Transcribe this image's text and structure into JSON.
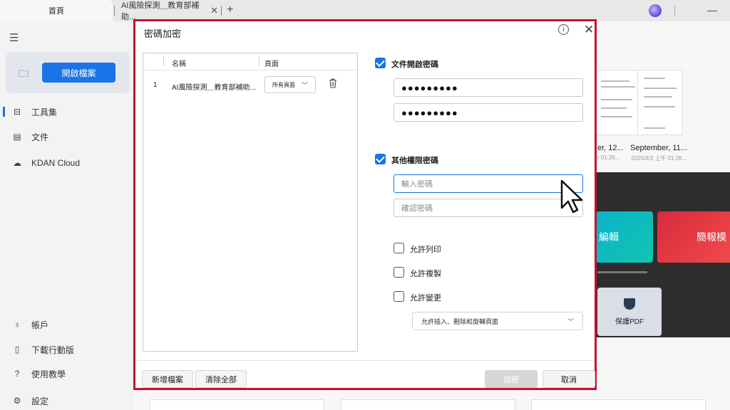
{
  "tabs": {
    "home_label": "首頁",
    "doc_label": "AI風險探測＿教育部補助...",
    "close_glyph": "✕",
    "new_tab_glyph": "+",
    "minimize_glyph": "—"
  },
  "sidebar": {
    "open_button": "開啟檔案",
    "items": [
      {
        "label": "工具集",
        "icon": "toolbox-icon"
      },
      {
        "label": "文件",
        "icon": "document-icon"
      },
      {
        "label": "KDAN Cloud",
        "icon": "cloud-icon"
      }
    ],
    "bottom_items": [
      {
        "label": "帳戶",
        "icon": "account-icon"
      },
      {
        "label": "下載行動版",
        "icon": "mobile-icon"
      },
      {
        "label": "使用教學",
        "icon": "help-icon"
      },
      {
        "label": "設定",
        "icon": "gear-icon"
      }
    ]
  },
  "background": {
    "recent": [
      {
        "title": "er, 12...",
        "sub": "r 01:26..."
      },
      {
        "title": "September, 11...",
        "sub": "2025/4/3 上午 01:26..."
      }
    ],
    "tool_card_1": "編輯",
    "tool_card_2": "簡報模",
    "protect_label": "保護PDF"
  },
  "dialog": {
    "title": "密碼加密",
    "file_table": {
      "col_name": "名稱",
      "col_pages": "頁面",
      "rows": [
        {
          "num": "1",
          "name": "AI風險探測＿教育部補助...",
          "pages": "所有頁面"
        }
      ]
    },
    "open_password": {
      "label": "文件開啟密碼",
      "checked": true,
      "password": "●●●●●●●●●",
      "confirm": "●●●●●●●●●"
    },
    "permission_password": {
      "label": "其他權限密碼",
      "checked": true,
      "placeholder": "輸入密碼",
      "confirm_placeholder": "確認密碼"
    },
    "permissions": {
      "print": "允許列印",
      "copy": "允許複製",
      "change": "允許變更",
      "change_option": "允許插入、刪除和旋轉頁面"
    },
    "footer": {
      "add_file": "新增檔案",
      "clear_all": "清除全部",
      "encrypt": "加密",
      "cancel": "取消"
    }
  },
  "colors": {
    "accent": "#1a73e8",
    "highlight_border": "#c8102e"
  }
}
